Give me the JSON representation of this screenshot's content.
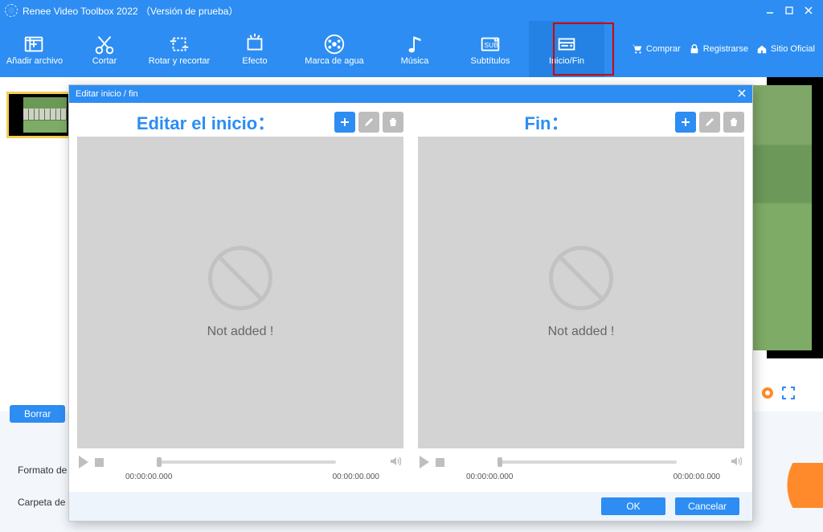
{
  "title": "Renee Video Toolbox 2022 （Versión de prueba）",
  "toolbar": {
    "items": [
      {
        "label": "Añadir archivo"
      },
      {
        "label": "Cortar"
      },
      {
        "label": "Rotar y recortar"
      },
      {
        "label": "Efecto"
      },
      {
        "label": "Marca de agua"
      },
      {
        "label": "Música"
      },
      {
        "label": "Subtítulos"
      },
      {
        "label": "Inicio/Fin"
      }
    ],
    "right": {
      "buy": "Comprar",
      "register": "Registrarse",
      "site": "Sitio Oficial"
    }
  },
  "workspace": {
    "delete_btn": "Borrar",
    "format_label": "Formato de",
    "folder_label": "Carpeta de"
  },
  "modal": {
    "title": "Editar inicio / fin",
    "start": {
      "title": "Editar el inicio：",
      "not_added": "Not added !",
      "time_start": "00:00:00.000",
      "time_end": "00:00:00.000"
    },
    "end": {
      "title": "Fin：",
      "not_added": "Not added !",
      "time_start": "00:00:00.000",
      "time_end": "00:00:00.000"
    },
    "ok": "OK",
    "cancel": "Cancelar"
  }
}
